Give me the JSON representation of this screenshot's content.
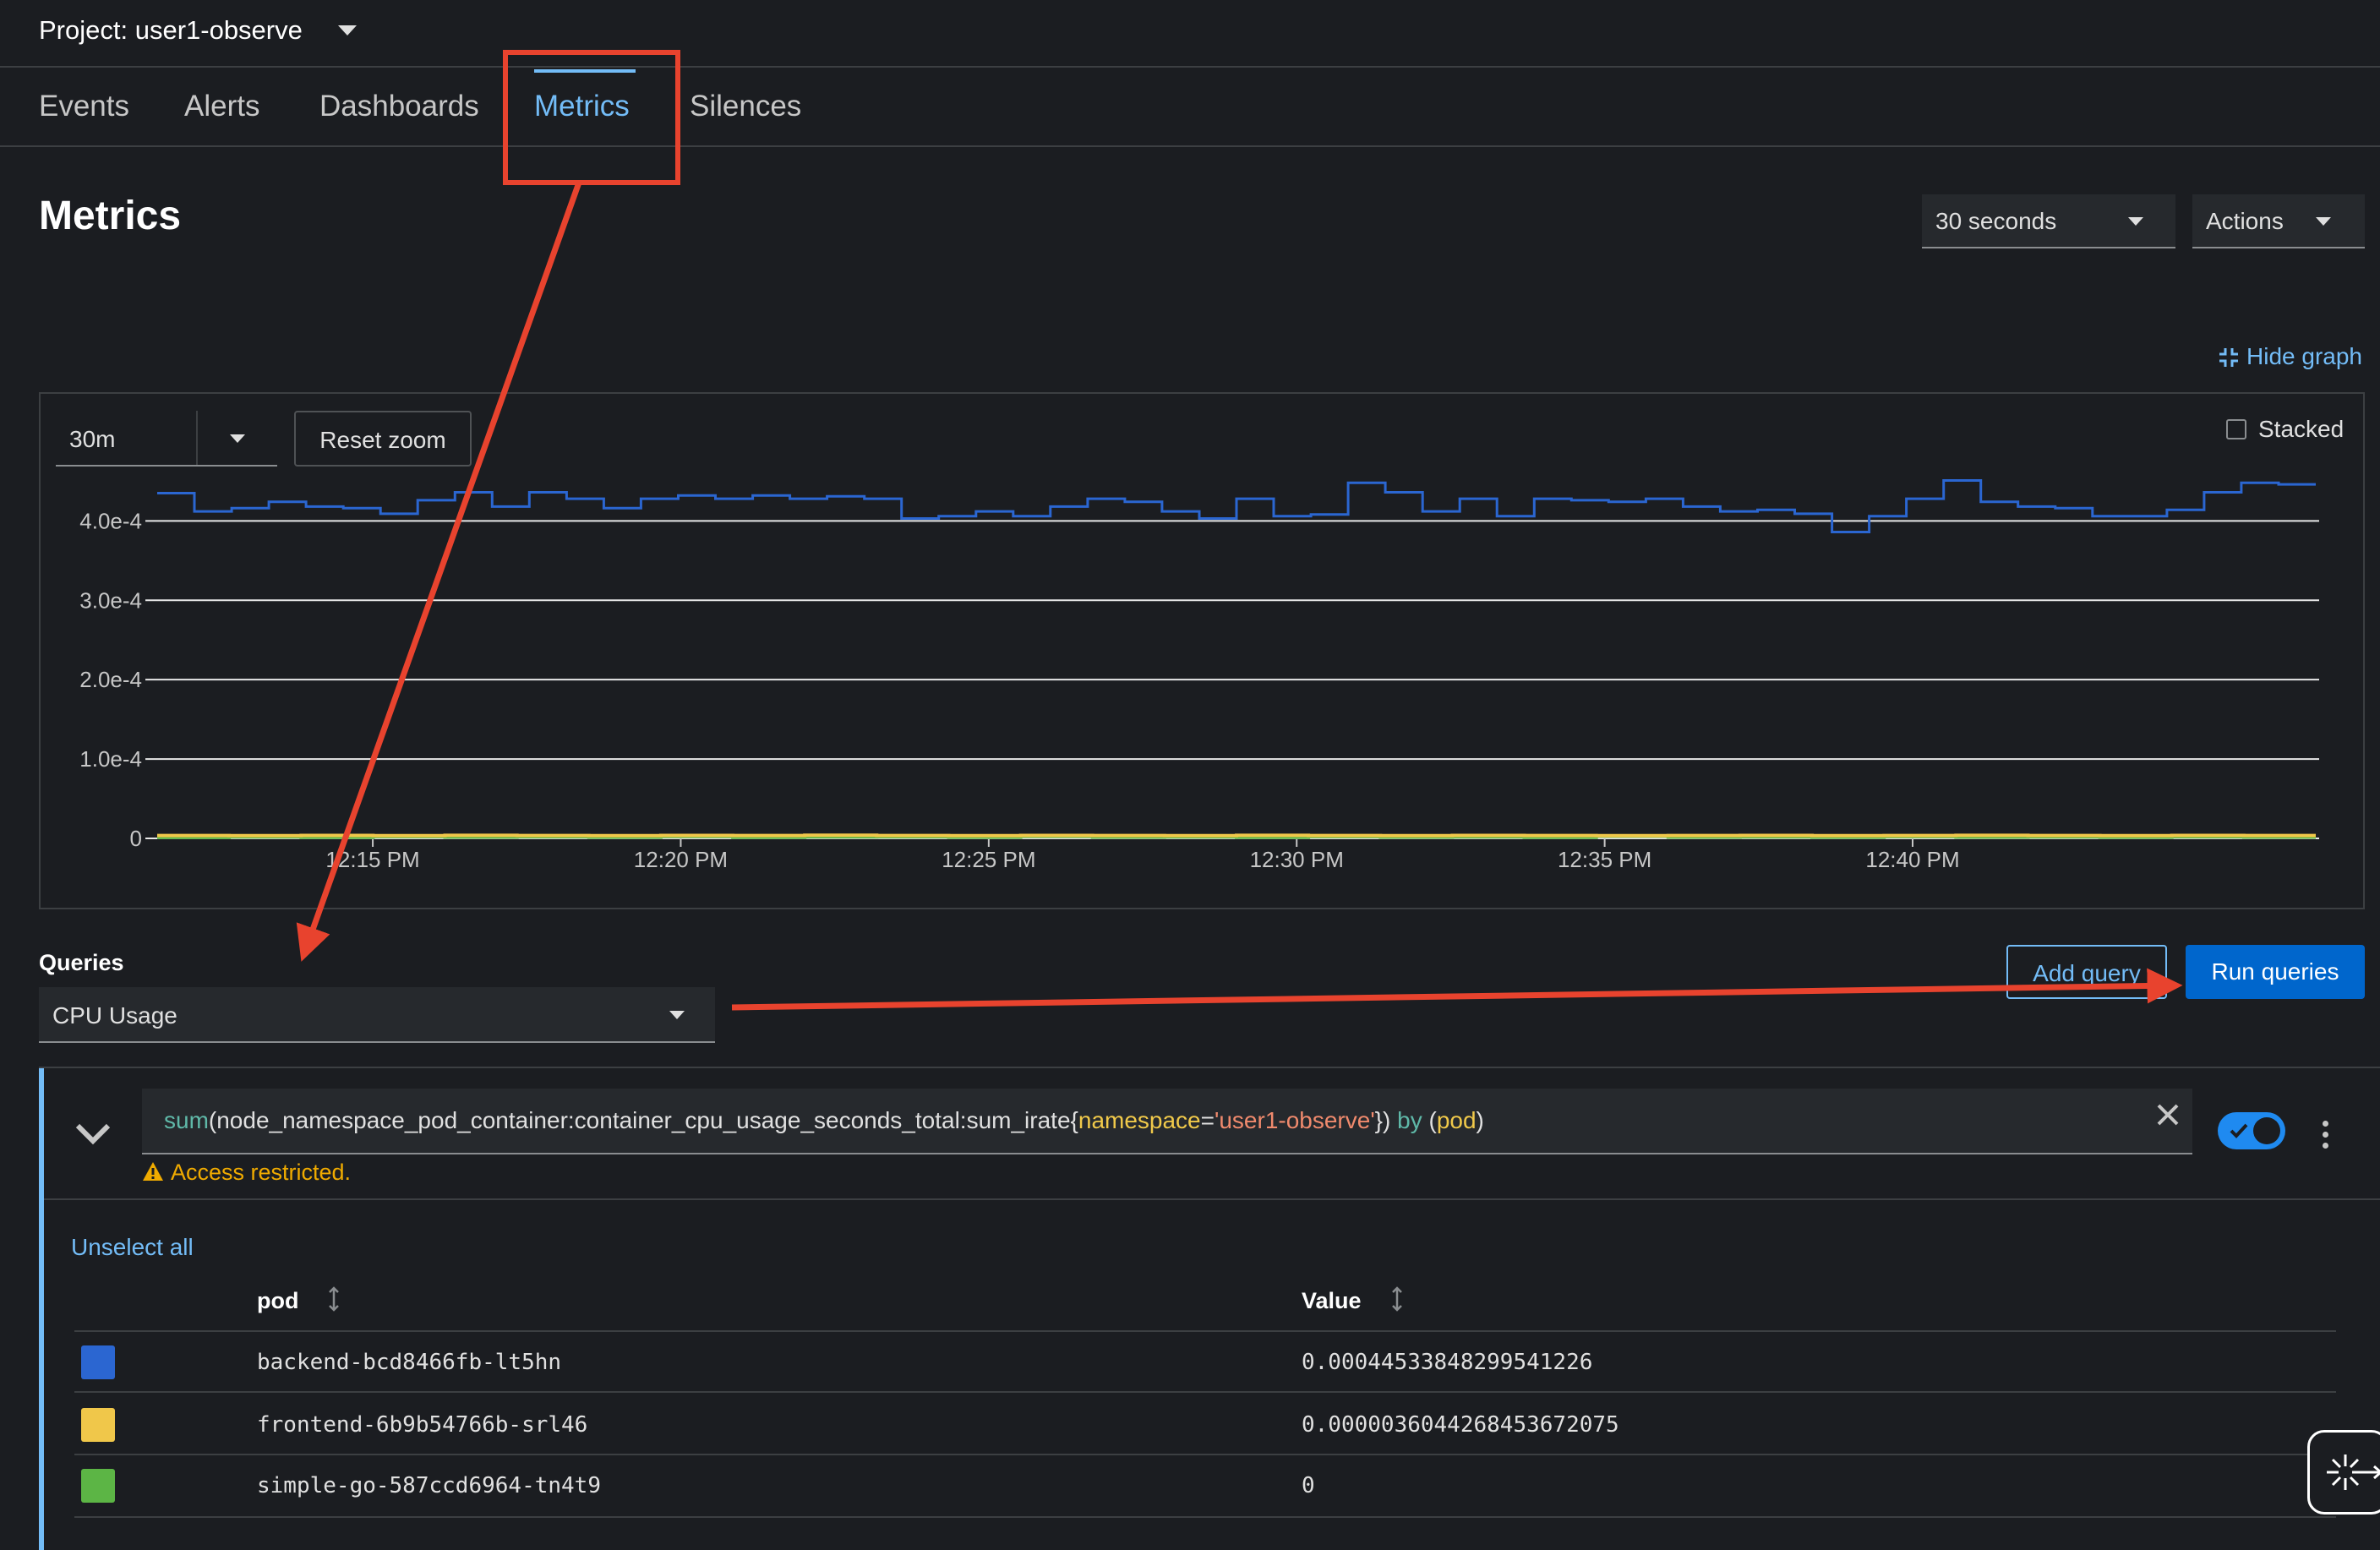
{
  "project": {
    "label": "Project: user1-observe"
  },
  "tabs": [
    {
      "label": "Events"
    },
    {
      "label": "Alerts"
    },
    {
      "label": "Dashboards"
    },
    {
      "label": "Metrics"
    },
    {
      "label": "Silences"
    }
  ],
  "header": {
    "title": "Metrics",
    "refresh_interval": "30 seconds",
    "actions_label": "Actions"
  },
  "graph": {
    "hide_graph_label": "Hide graph",
    "time_range": "30m",
    "reset_zoom_label": "Reset zoom",
    "stacked_label": "Stacked"
  },
  "chart_data": {
    "type": "line",
    "title": "",
    "xlabel": "",
    "ylabel": "",
    "ylim": [
      0,
      0.00046
    ],
    "y_ticks": [
      "0",
      "1.0e-4",
      "2.0e-4",
      "3.0e-4",
      "4.0e-4"
    ],
    "y_tick_values": [
      0,
      0.0001,
      0.0002,
      0.0003,
      0.0004
    ],
    "x_ticks": [
      "12:15 PM",
      "12:20 PM",
      "12:25 PM",
      "12:30 PM",
      "12:35 PM",
      "12:40 PM"
    ],
    "x_tick_minutes": [
      15,
      20,
      25,
      30,
      35,
      40
    ],
    "x_range_minutes": [
      11.5,
      46.6
    ],
    "grid": true,
    "series": [
      {
        "name": "backend-bcd8466fb-lt5hn",
        "color": "#2b66d1",
        "values": [
          0.000435,
          0.000412,
          0.000416,
          0.000424,
          0.000418,
          0.000416,
          0.000409,
          0.000426,
          0.000436,
          0.000418,
          0.000436,
          0.000428,
          0.000416,
          0.000428,
          0.000432,
          0.000428,
          0.000432,
          0.000428,
          0.000431,
          0.000428,
          0.000403,
          0.000406,
          0.000412,
          0.000406,
          0.000418,
          0.000428,
          0.000424,
          0.000412,
          0.000403,
          0.000428,
          0.000406,
          0.000408,
          0.000448,
          0.000436,
          0.000412,
          0.000428,
          0.000406,
          0.000428,
          0.000426,
          0.000424,
          0.000428,
          0.000418,
          0.000412,
          0.000414,
          0.000409,
          0.000386,
          0.000406,
          0.000428,
          0.000451,
          0.000424,
          0.000418,
          0.000416,
          0.000406,
          0.000406,
          0.000414,
          0.000436,
          0.000448,
          0.000446
        ]
      },
      {
        "name": "frontend-6b9b54766b-srl46",
        "color": "#f0c74a",
        "values": [
          3.6e-06,
          3.4e-06,
          3.7e-06,
          3.5e-06,
          3.8e-06,
          3.6e-06,
          3.5e-06,
          3.7e-06,
          3.6e-06,
          3.9e-06,
          3.6e-06,
          3.5e-06,
          3.7e-06,
          3.6e-06,
          3.5e-06,
          3.8e-06,
          3.6e-06,
          3.5e-06,
          3.7e-06,
          3.6e-06,
          3.5e-06,
          3.6e-06,
          3.7e-06,
          3.5e-06,
          3.6e-06,
          3.8e-06,
          3.6e-06,
          3.5e-06,
          3.7e-06,
          3.6e-06
        ]
      },
      {
        "name": "simple-go-587ccd6964-tn4t9",
        "color": "#5cb545",
        "values": [
          1.2e-06,
          1.8e-06,
          1.4e-06,
          2.2e-06,
          1.6e-06,
          2e-06,
          1.5e-06,
          2.4e-06,
          1.4e-06,
          1.8e-06,
          2e-06,
          1.5e-06,
          2.6e-06,
          1.6e-06,
          1.8e-06,
          1.4e-06,
          2.2e-06,
          1.6e-06,
          1.9e-06,
          1.4e-06,
          2.8e-06,
          1.6e-06,
          1.8e-06,
          1.5e-06,
          2.2e-06,
          1.6e-06,
          1.8e-06,
          1.5e-06,
          2e-06,
          1.6e-06
        ]
      }
    ]
  },
  "queries": {
    "label": "Queries",
    "preset": "CPU Usage",
    "add_query_label": "Add query",
    "run_queries_label": "Run queries",
    "query": {
      "fn": "sum",
      "metric": "(node_namespace_pod_container:container_cpu_usage_seconds_total:sum_irate{",
      "label_key": "namespace",
      "eq": "=",
      "label_value": "'user1-observe'",
      "close": "}) ",
      "by_kw": "by",
      "by_open": " (",
      "by_label": "pod",
      "by_close": ")"
    },
    "warning": "Access restricted.",
    "unselect_all_label": "Unselect all",
    "table": {
      "columns": [
        "pod",
        "Value"
      ],
      "rows": [
        {
          "color": "#2b66d1",
          "pod": "backend-bcd8466fb-lt5hn",
          "value": "0.00044533848299541226"
        },
        {
          "color": "#f0c74a",
          "pod": "frontend-6b9b54766b-srl46",
          "value": "0.000003604426845367207​5"
        },
        {
          "color": "#5cb545",
          "pod": "simple-go-587ccd6964-tn4t9",
          "value": "0"
        }
      ]
    }
  },
  "annotation": {
    "color": "#e8432e"
  }
}
